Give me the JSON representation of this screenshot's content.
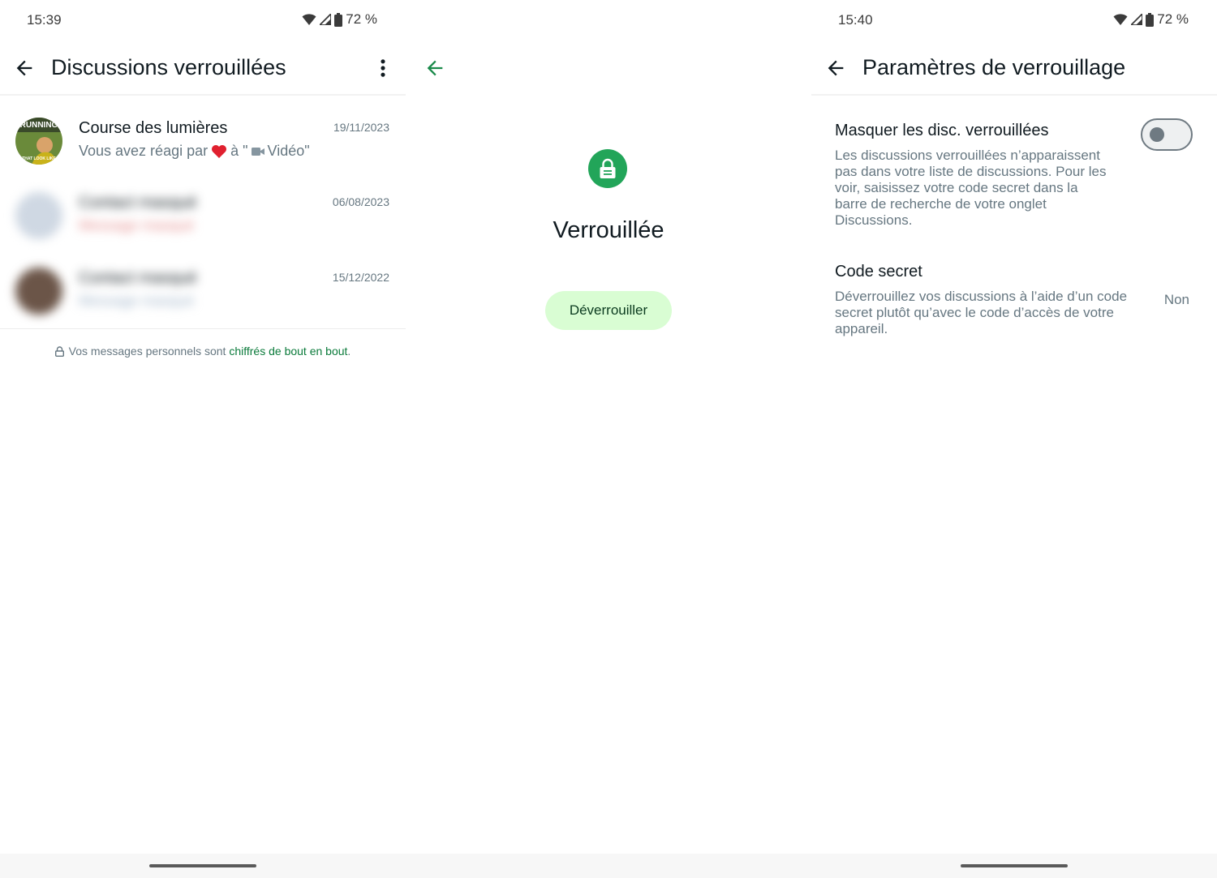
{
  "left": {
    "status": {
      "time": "15:39",
      "battery": "72 %"
    },
    "appbar": {
      "title": "Discussions verrouillées"
    },
    "chats": [
      {
        "name": "Course des lumières",
        "preview_prefix": "Vous avez réagi par",
        "preview_mid": "à \"",
        "preview_suffix": "Vidéo\"",
        "date": "19/11/2023",
        "avatar_text": "RUNNING",
        "avatar_subtext": "THAT LOOK LIKE"
      },
      {
        "name": "Contact masqué",
        "preview": "Message masqué",
        "date": "06/08/2023"
      },
      {
        "name": "Contact masqué",
        "preview": "Message masqué",
        "date": "15/12/2022"
      }
    ],
    "e2e": {
      "prefix": "Vos messages personnels sont ",
      "link": "chiffrés de bout en bout",
      "suffix": "."
    }
  },
  "middle": {
    "title": "Verrouillée",
    "unlock_label": "Déverrouiller"
  },
  "right": {
    "status": {
      "time": "15:40",
      "battery": "72 %"
    },
    "appbar": {
      "title": "Paramètres de verrouillage"
    },
    "hide_setting": {
      "title": "Masquer les disc. verrouillées",
      "description": "Les discussions verrouillées n’apparaissent pas dans votre liste de discussions. Pour les voir, saisissez votre code secret dans la barre de recherche de votre onglet Discussions.",
      "enabled": false
    },
    "secret_code": {
      "title": "Code secret",
      "description": "Déverrouillez vos discussions à l’aide d’un code secret plutôt qu’avec le code d’accès de votre appareil.",
      "value": "Non"
    }
  },
  "colors": {
    "accent_green": "#22a559",
    "link_green": "#0a7a3a",
    "button_bg": "#d9fdd3",
    "secondary_text": "#667781"
  },
  "icons": [
    "back-arrow-icon",
    "more-vert-icon",
    "lock-icon",
    "wifi-icon",
    "signal-icon",
    "battery-icon",
    "heart-icon",
    "video-icon"
  ]
}
